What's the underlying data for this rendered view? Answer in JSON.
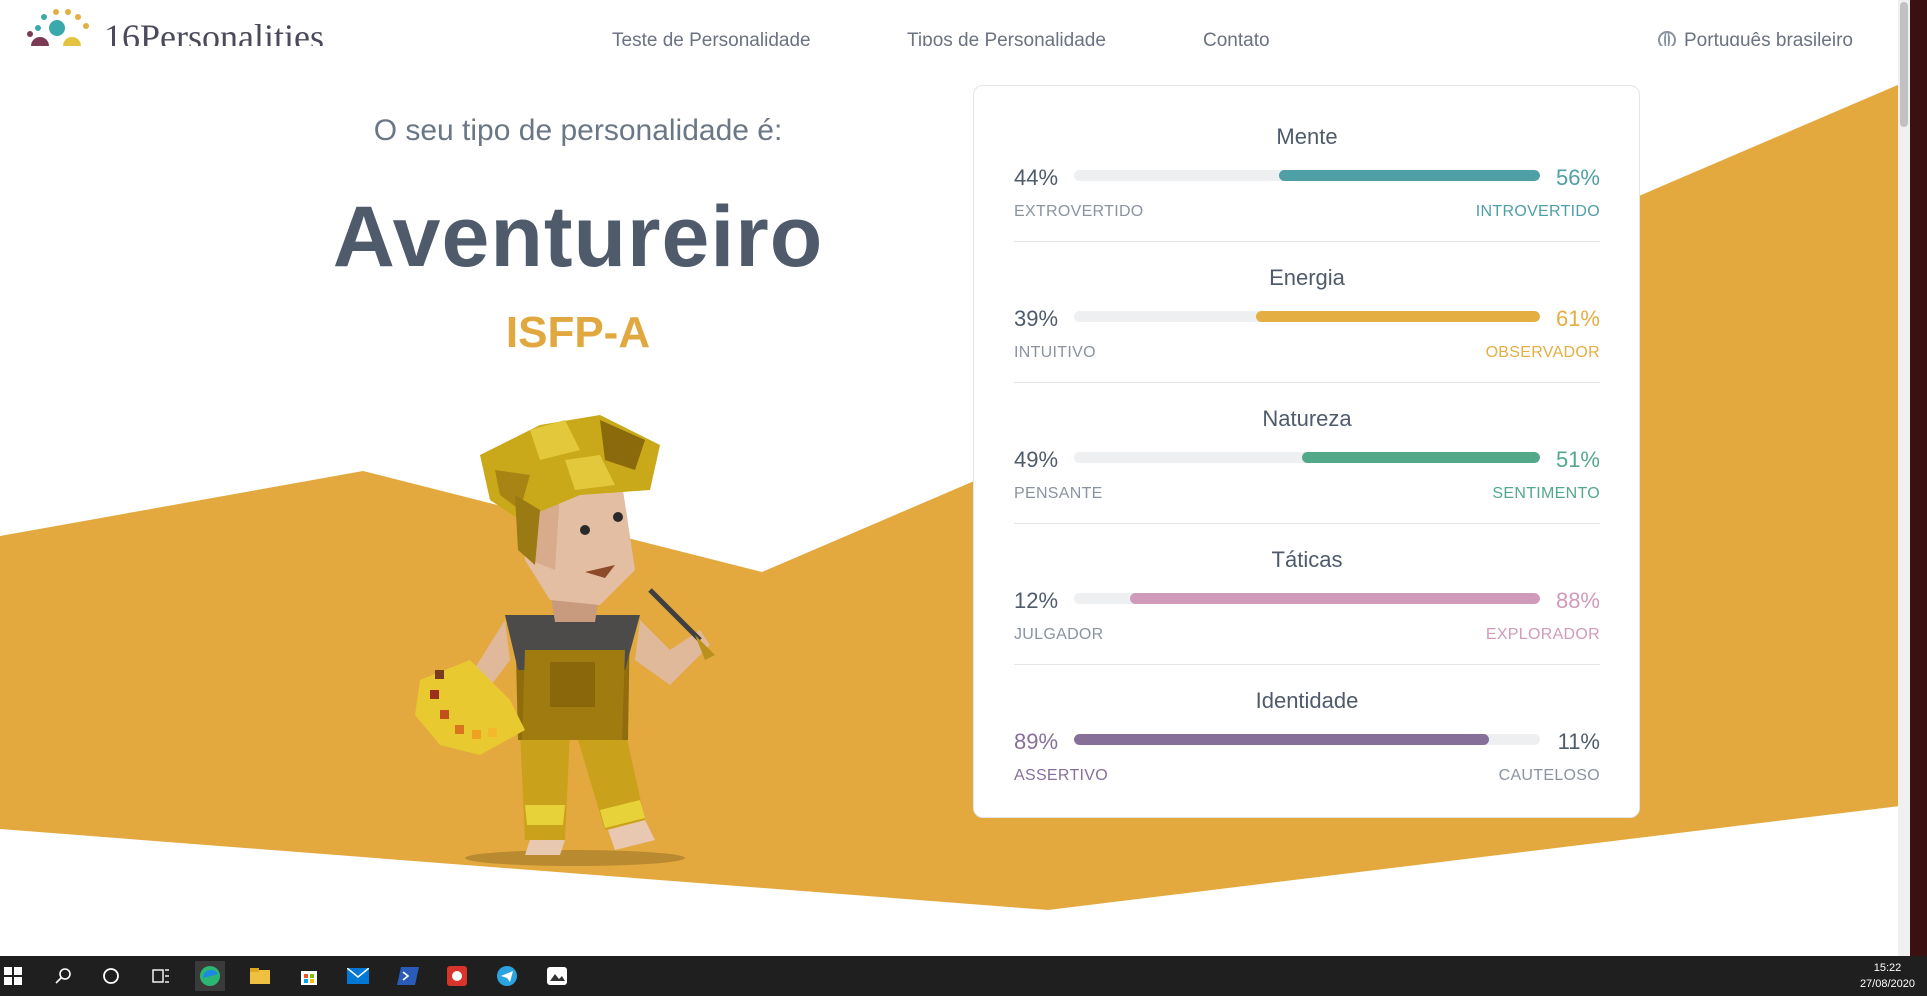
{
  "colors": {
    "gold": "#e0a83e",
    "mente": "#4f9fa6",
    "energia": "#e4ae43",
    "natureza": "#53a88a",
    "taticas": "#d09bbb",
    "identidade": "#86709a",
    "neutral": "#4f5b6b",
    "muted": "#8a93a0"
  },
  "header": {
    "logo_text": "16Personalities",
    "nav": [
      "Teste de Personalidade",
      "Tipos de Personalidade",
      "Contato"
    ],
    "language": "Português brasileiro",
    "icons": {
      "logo": "dots-logo-icon",
      "language": "globe-icon"
    }
  },
  "hero": {
    "intro": "O seu tipo de personalidade é:",
    "type_name": "Aventureiro",
    "type_code": "ISFP-A",
    "illustration": "painter-character-illustration"
  },
  "traits": [
    {
      "title": "Mente",
      "left_pct": "44%",
      "right_pct": "56%",
      "left_label": "EXTROVERTIDO",
      "right_label": "INTROVERTIDO",
      "dominant": "right",
      "value": 56,
      "color": "#4f9fa6"
    },
    {
      "title": "Energia",
      "left_pct": "39%",
      "right_pct": "61%",
      "left_label": "INTUITIVO",
      "right_label": "OBSERVADOR",
      "dominant": "right",
      "value": 61,
      "color": "#e4ae43"
    },
    {
      "title": "Natureza",
      "left_pct": "49%",
      "right_pct": "51%",
      "left_label": "PENSANTE",
      "right_label": "SENTIMENTO",
      "dominant": "right",
      "value": 51,
      "color": "#53a88a"
    },
    {
      "title": "Táticas",
      "left_pct": "12%",
      "right_pct": "88%",
      "left_label": "JULGADOR",
      "right_label": "EXPLORADOR",
      "dominant": "right",
      "value": 88,
      "color": "#d09bbb"
    },
    {
      "title": "Identidade",
      "left_pct": "89%",
      "right_pct": "11%",
      "left_label": "ASSERTIVO",
      "right_label": "CAUTELOSO",
      "dominant": "left",
      "value": 89,
      "color": "#86709a"
    }
  ],
  "taskbar": {
    "icons": [
      "windows-start-icon",
      "search-icon",
      "cortana-icon",
      "task-view-icon",
      "edge-icon",
      "file-explorer-icon",
      "store-icon",
      "mail-icon",
      "powershell-icon",
      "record-app-icon",
      "telegram-icon",
      "photos-app-icon"
    ],
    "time": "15:22",
    "date": "27/08/2020"
  }
}
